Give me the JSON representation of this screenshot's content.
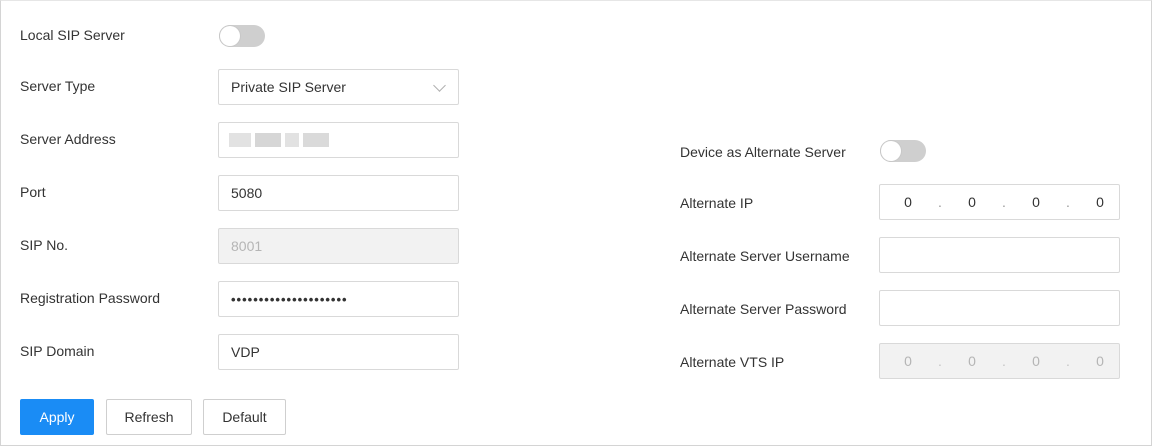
{
  "left": {
    "local_sip_server": {
      "label": "Local SIP Server",
      "enabled": false
    },
    "server_type": {
      "label": "Server Type",
      "value": "Private SIP Server"
    },
    "server_address": {
      "label": "Server Address",
      "value": ""
    },
    "port": {
      "label": "Port",
      "value": "5080"
    },
    "sip_no": {
      "label": "SIP No.",
      "value": "8001"
    },
    "registration_password": {
      "label": "Registration Password",
      "value": "•••••••••••••••••••••"
    },
    "sip_domain": {
      "label": "SIP Domain",
      "value": "VDP"
    }
  },
  "right": {
    "device_as_alternate": {
      "label": "Device as Alternate Server",
      "enabled": false
    },
    "alternate_ip": {
      "label": "Alternate IP",
      "octets": [
        "0",
        "0",
        "0",
        "0"
      ]
    },
    "alternate_username": {
      "label": "Alternate Server Username",
      "value": ""
    },
    "alternate_password": {
      "label": "Alternate Server Password",
      "value": ""
    },
    "alternate_vts_ip": {
      "label": "Alternate VTS IP",
      "octets": [
        "0",
        "0",
        "0",
        "0"
      ]
    }
  },
  "buttons": {
    "apply": "Apply",
    "refresh": "Refresh",
    "default": "Default"
  },
  "colors": {
    "primary": "#1a8cf5",
    "toggle_off": "#cfcfcf",
    "disabled_bg": "#f2f2f2"
  },
  "icons": {
    "server_type_dropdown": "chevron-down-icon"
  }
}
